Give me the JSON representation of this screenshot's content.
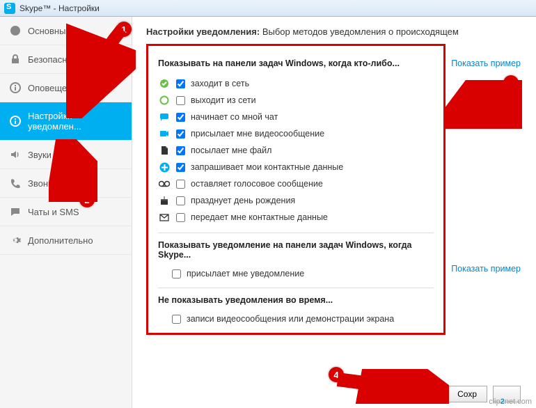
{
  "window": {
    "title": "Skype™ - Настройки"
  },
  "sidebar": {
    "items": [
      {
        "label": "Основные",
        "name": "sidebar-item-general"
      },
      {
        "label": "Безопасность",
        "name": "sidebar-item-security"
      },
      {
        "label": "Оповещения",
        "name": "sidebar-item-alerts"
      },
      {
        "label": "Настройки уведомлен...",
        "name": "sidebar-item-notifications"
      },
      {
        "label": "Звуки",
        "name": "sidebar-item-sounds"
      },
      {
        "label": "Звонки",
        "name": "sidebar-item-calls"
      },
      {
        "label": "Чаты и SMS",
        "name": "sidebar-item-chats"
      },
      {
        "label": "Дополнительно",
        "name": "sidebar-item-advanced"
      }
    ],
    "active_index": 3
  },
  "heading": {
    "strong": "Настройки уведомления:",
    "rest": "Выбор методов уведомления о происходящем"
  },
  "links": {
    "show_example": "Показать пример"
  },
  "sections": {
    "taskbar": {
      "title": "Показывать на панели задач Windows, когда кто-либо...",
      "options": [
        {
          "label": "заходит в сеть",
          "checked": true,
          "icon": "status-online"
        },
        {
          "label": "выходит из сети",
          "checked": false,
          "icon": "status-offline"
        },
        {
          "label": "начинает со мной чат",
          "checked": true,
          "icon": "chat"
        },
        {
          "label": "присылает мне видеосообщение",
          "checked": true,
          "icon": "video"
        },
        {
          "label": "посылает мне файл",
          "checked": true,
          "icon": "file"
        },
        {
          "label": "запрашивает мои контактные данные",
          "checked": true,
          "icon": "add-contact"
        },
        {
          "label": "оставляет голосовое сообщение",
          "checked": false,
          "icon": "voicemail"
        },
        {
          "label": "празднует день рождения",
          "checked": false,
          "icon": "birthday"
        },
        {
          "label": "передает мне контактные данные",
          "checked": false,
          "icon": "send-contact"
        }
      ]
    },
    "skype": {
      "title": "Показывать уведомление на панели задач Windows, когда Skype...",
      "options": [
        {
          "label": "присылает мне уведомление",
          "checked": false
        }
      ]
    },
    "suppress": {
      "title": "Не показывать уведомления во время...",
      "options": [
        {
          "label": "записи видеосообщения или демонстрации экрана",
          "checked": false
        }
      ]
    }
  },
  "buttons": {
    "save": "Сохр"
  },
  "annotations": {
    "n1": "1",
    "n2": "2",
    "n3": "3",
    "n4": "4"
  },
  "watermark": {
    "a": "clip",
    "b": "2",
    "c": "net",
    "d": ".com"
  }
}
